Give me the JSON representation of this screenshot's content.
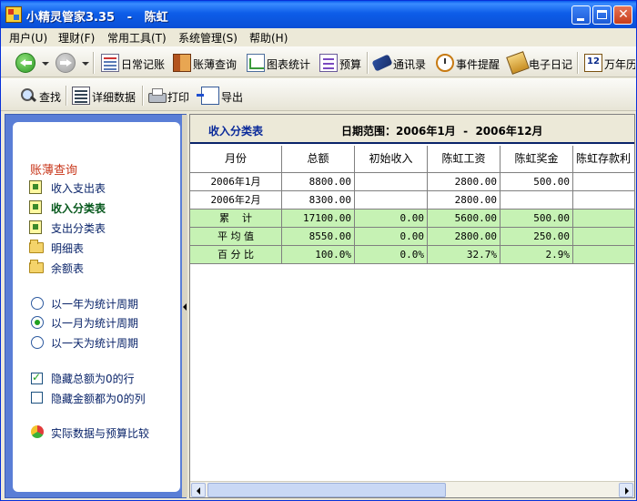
{
  "window": {
    "title": "小精灵管家3.35   -   陈虹"
  },
  "menu": [
    {
      "label": "用户(U)"
    },
    {
      "label": "理财(F)"
    },
    {
      "label": "常用工具(T)"
    },
    {
      "label": "系统管理(S)"
    },
    {
      "label": "帮助(H)"
    }
  ],
  "toolbar1": {
    "daily": "日常记账",
    "ledger_query": "账薄查询",
    "chart_stats": "图表统计",
    "budget": "预算",
    "contacts": "通讯录",
    "reminder": "事件提醒",
    "diary": "电子日记",
    "calendar": "万年历"
  },
  "toolbar2": {
    "find": "查找",
    "detail": "详细数据",
    "print": "打印",
    "export": "导出"
  },
  "sidebar": {
    "section_title": "账薄查询",
    "items": [
      {
        "label": "收入支出表"
      },
      {
        "label": "收入分类表"
      },
      {
        "label": "支出分类表"
      },
      {
        "label": "明细表"
      },
      {
        "label": "余额表"
      }
    ],
    "period_options": [
      {
        "label": "以一年为统计周期"
      },
      {
        "label": "以一月为统计周期"
      },
      {
        "label": "以一天为统计周期"
      }
    ],
    "checkboxes": [
      {
        "label": "隐藏总额为0的行"
      },
      {
        "label": "隐藏金额都为0的列"
      }
    ],
    "compare": "实际数据与预算比较"
  },
  "report": {
    "title": "收入分类表",
    "date_range": "日期范围：2006年1月  -  2006年12月",
    "columns": [
      "月份",
      "总额",
      "初始收入",
      "陈虹工资",
      "陈虹奖金",
      "陈虹存款利"
    ],
    "rows": [
      [
        "2006年1月",
        "8800.00",
        "",
        "2800.00",
        "500.00",
        ""
      ],
      [
        "2006年2月",
        "8300.00",
        "",
        "2800.00",
        "",
        ""
      ]
    ],
    "summary_rows": [
      [
        "累    计",
        "17100.00",
        "0.00",
        "5600.00",
        "500.00",
        ""
      ],
      [
        "平 均 值",
        "8550.00",
        "0.00",
        "2800.00",
        "250.00",
        ""
      ],
      [
        "百 分 比",
        "100.0%",
        "0.0%",
        "32.7%",
        "2.9%",
        ""
      ]
    ]
  },
  "colors": {
    "titlebar": "#0a4fd6",
    "summary_row_bg": "#c6f2b4",
    "section_title": "#c8361a",
    "panel_blue": "#5a7ed6"
  }
}
